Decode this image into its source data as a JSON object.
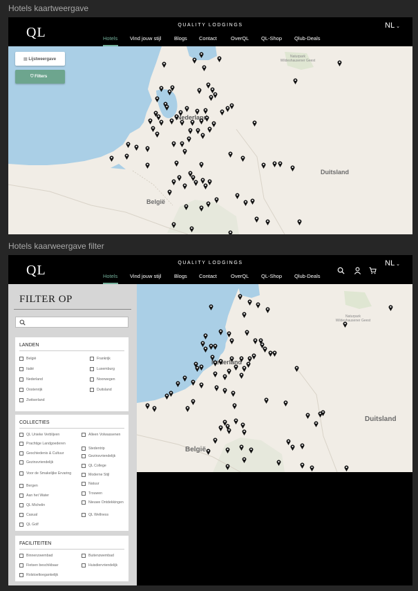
{
  "screens": {
    "list_view": {
      "label": "Hotels kaartweergave"
    },
    "filter_view": {
      "label": "Hotels kaarweergave filter"
    }
  },
  "header": {
    "logo": "QL",
    "brand": "QUALITY LODGINGS",
    "language": "NL",
    "nav": [
      "Hotels",
      "Vind jouw stijl",
      "Blogs",
      "Contact",
      "OverQL",
      "QL-Shop",
      "Qlub-Deals"
    ],
    "active_nav": "Hotels",
    "icons": [
      "search-icon",
      "user-icon",
      "cart-icon"
    ]
  },
  "map": {
    "list_button": "Lijstweergave",
    "filters_button": "Filters",
    "labels": {
      "country_de": "Duitsland",
      "country_be": "België",
      "city_nl": "Nederland",
      "park": "Naturpark Wildeshausener Geest"
    }
  },
  "filter": {
    "title": "FILTER OP",
    "search": {
      "value": "",
      "placeholder": ""
    },
    "landen": {
      "title": "LANDEN",
      "options": [
        "België",
        "Frankrijk",
        "Italië",
        "Luxemburg",
        "Nederland",
        "Noorwegen",
        "Oostenrijk",
        "Duitsland",
        "Zwitserland"
      ]
    },
    "collecties": {
      "title": "COLLECTIES",
      "options": [
        "QL Unieke Verblijven",
        "Alleen Volwassenen",
        "Prachtige Landgoederen",
        "Stedentrip",
        "Geschiedenis & Cultuur",
        "Gezinsvriendelijk",
        "Gezinsvriendelijk",
        "QL College",
        "Voor de Smakelijke Ervaring",
        "Moderne Stijl",
        "Bergen",
        "Natuur",
        "Aan het Water",
        "Trouwen",
        "QL Michelin",
        "Nieuwe Ontdekkingen",
        "Casual",
        "QL Wellness",
        "QL Golf"
      ]
    },
    "faciliteiten": {
      "title": "FACILITEITEN",
      "options": [
        "Binnenzwembad",
        "Buitenzwembad",
        "Fietsen beschikbaar",
        "Huisdiervriendelijk",
        "Rolstoeltoegankelijk"
      ]
    }
  },
  "colors": {
    "accent": "#74b09b",
    "map_land": "#f1ede6",
    "map_water": "#aacfe6",
    "background": "#262626",
    "header": "#000000"
  }
}
